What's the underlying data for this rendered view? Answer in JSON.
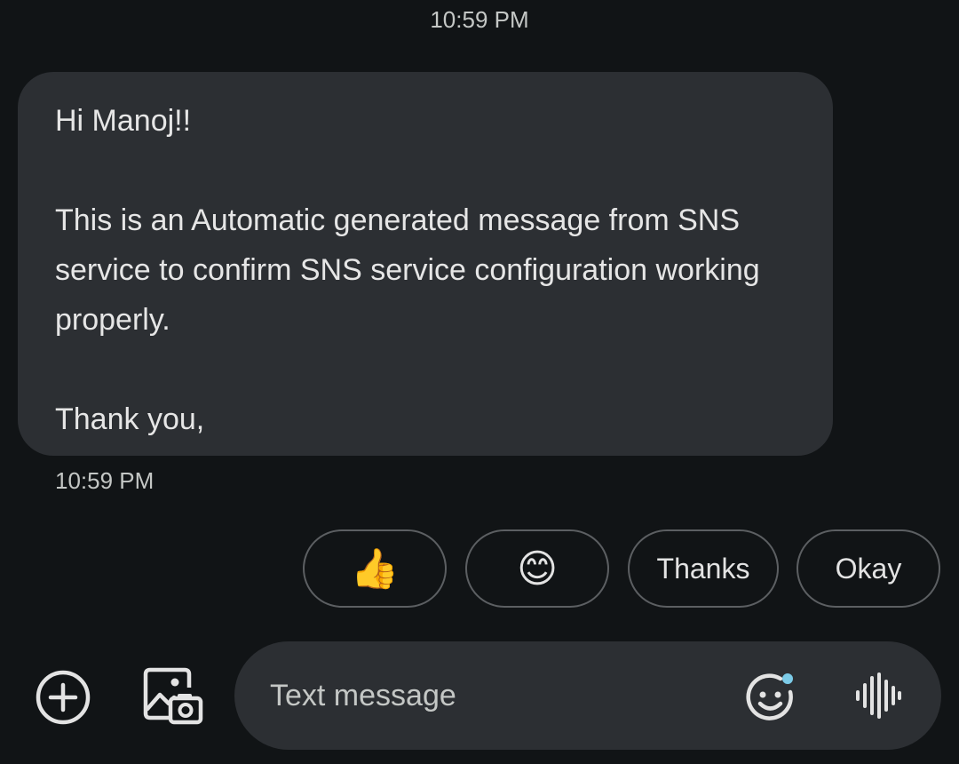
{
  "conversation": {
    "top_timestamp": "10:59 PM",
    "message": {
      "text": "Hi Manoj!!\n\nThis is an Automatic generated message from SNS service to confirm SNS service configuration working properly.\n\nThank you,",
      "timestamp": "10:59 PM"
    }
  },
  "smart_replies": [
    {
      "label": "👍",
      "icon": "thumbs-up-emoji"
    },
    {
      "label": "😊",
      "icon": "smiling-face-emoji"
    },
    {
      "label": "Thanks"
    },
    {
      "label": "Okay"
    }
  ],
  "compose": {
    "placeholder": "Text message",
    "value": "",
    "icons": {
      "add": "add-circle-icon",
      "media": "gallery-camera-icon",
      "emoji": "emoji-icon",
      "voice": "voice-waveform-icon"
    }
  },
  "colors": {
    "background": "#111416",
    "bubble": "#2c2f33",
    "text": "#e3e3e3",
    "chip_border": "#5c5f62",
    "emoji_dot": "#7ccbe8"
  }
}
